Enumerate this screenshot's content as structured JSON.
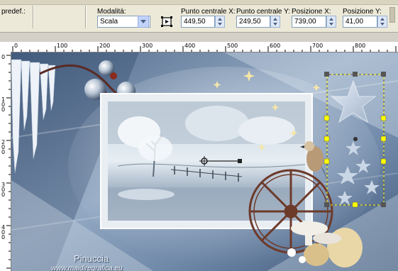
{
  "toolbar": {
    "preset_label": "predef.:",
    "mode_label": "Modalità:",
    "mode_value": "Scala",
    "center_x_label": "Punto centrale X:",
    "center_x_value": "449,50",
    "center_y_label": "Punto centrale Y:",
    "center_y_value": "249,50",
    "pos_x_label": "Posizione X:",
    "pos_x_value": "739,00",
    "pos_y_label": "Posizione Y:",
    "pos_y_value": "41,00"
  },
  "ruler": {
    "top_ticks": [
      "0",
      "100",
      "200",
      "300",
      "400",
      "500",
      "600",
      "700",
      "800"
    ],
    "left_ticks": [
      "0",
      "1\n0\n0",
      "2\n0\n0",
      "3\n0\n0",
      "4\n0\n0"
    ]
  },
  "canvas": {
    "watermark_title": "Pinuccia",
    "watermark_url": "www.maidiregrafica.eu"
  },
  "icons": [
    "pick-tool-mode-icon",
    "spin-up-down-icon",
    "dropdown-arrow-icon",
    "rotation-pivot-icon"
  ],
  "colors": {
    "toolbar_bg": "#ece9d8",
    "canvas_blue": "#8aa0bb",
    "selection_handle": "#ffff00",
    "selection_border": "#555555"
  }
}
